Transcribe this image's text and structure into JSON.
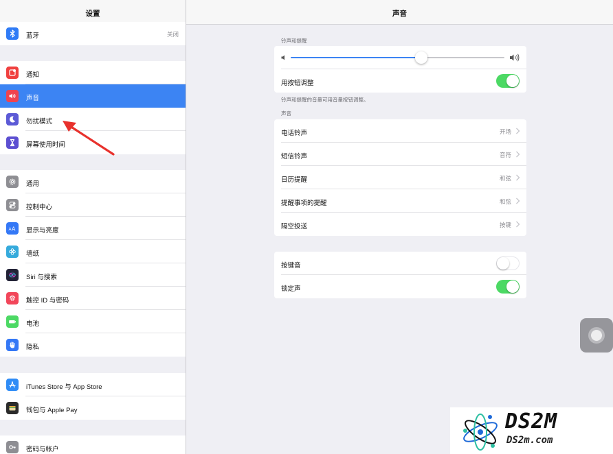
{
  "sidebar": {
    "title": "设置",
    "items": [
      {
        "label": "蓝牙",
        "value": "关闭",
        "icon": "bluetooth-icon",
        "color": "#2f7bf6"
      },
      {
        "label": "通知",
        "icon": "notifications-icon",
        "color": "#f0403f"
      },
      {
        "label": "声音",
        "icon": "speaker-icon",
        "color": "#f0434f",
        "selected": true
      },
      {
        "label": "勿扰模式",
        "icon": "moon-icon",
        "color": "#5c5ad6"
      },
      {
        "label": "屏幕使用时间",
        "icon": "hourglass-icon",
        "color": "#5c4fd1"
      },
      {
        "label": "通用",
        "icon": "gear-icon",
        "color": "#8e8e93"
      },
      {
        "label": "控制中心",
        "icon": "switches-icon",
        "color": "#8e8e93"
      },
      {
        "label": "显示与亮度",
        "icon": "text-size-icon",
        "color": "#3478f6"
      },
      {
        "label": "墙纸",
        "icon": "flower-icon",
        "color": "#35aadc"
      },
      {
        "label": "Siri 与搜索",
        "icon": "siri-icon",
        "color": "#222236"
      },
      {
        "label": "触控 ID 与密码",
        "icon": "fingerprint-icon",
        "color": "#f2465a"
      },
      {
        "label": "电池",
        "icon": "battery-icon",
        "color": "#4cd964"
      },
      {
        "label": "隐私",
        "icon": "hand-icon",
        "color": "#3478f6"
      },
      {
        "label": "iTunes Store 与 App Store",
        "icon": "app-store-icon",
        "color": "#2f8cf6"
      },
      {
        "label": "钱包与 Apple Pay",
        "icon": "wallet-icon",
        "color": "#2b2b2b"
      },
      {
        "label": "密码与帐户",
        "icon": "key-icon",
        "color": "#8e8e93"
      }
    ]
  },
  "main": {
    "title": "声音",
    "ringer_section_label": "铃声和提醒",
    "ringer_volume": 0.61,
    "change_with_buttons": {
      "label": "用按钮调整",
      "on": true
    },
    "helper_text": "铃声和提醒的音量可用音量按钮调整。",
    "sounds_section_label": "声音",
    "sounds": [
      {
        "label": "电话铃声",
        "value": "开场"
      },
      {
        "label": "短信铃声",
        "value": "音符"
      },
      {
        "label": "日历提醒",
        "value": "和弦"
      },
      {
        "label": "提醒事项的提醒",
        "value": "和弦"
      },
      {
        "label": "隔空投送",
        "value": "按键"
      }
    ],
    "keyboard_clicks": {
      "label": "按键音",
      "on": false
    },
    "lock_sound": {
      "label": "锁定声",
      "on": true
    }
  },
  "colors": {
    "accent": "#3c84f3",
    "toggle_on": "#4cd964",
    "annotation_arrow": "#e8312c"
  },
  "watermark": {
    "logo": "DS2M",
    "site": "DS2m.com"
  }
}
